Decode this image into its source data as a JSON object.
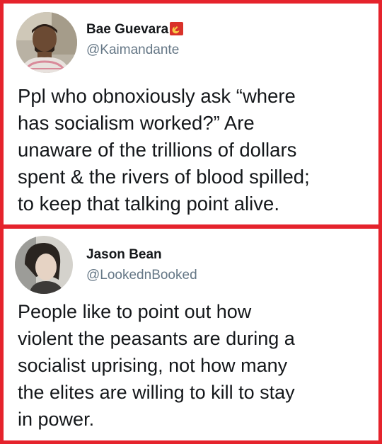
{
  "tweets": [
    {
      "name": "Bae Guevara",
      "handle": "@Kaimandante",
      "text": "Ppl who obnoxiously ask “where\nhas socialism worked?” Are\nunaware of the trillions of dollars\nspent & the rivers of blood spilled;\nto keep that talking point alive.",
      "badge_icon": "hammer-sickle-flag-icon"
    },
    {
      "name": "Jason Bean",
      "handle": "@LookednBooked",
      "text": "People like to point out how\nviolent the peasants are during a\nsocialist uprising, not  how many\nthe elites are willing to kill to stay\nin power."
    }
  ],
  "colors": {
    "border": "#e5232c",
    "text": "#14171a",
    "handle": "#657786",
    "flag": "#d9322a"
  }
}
